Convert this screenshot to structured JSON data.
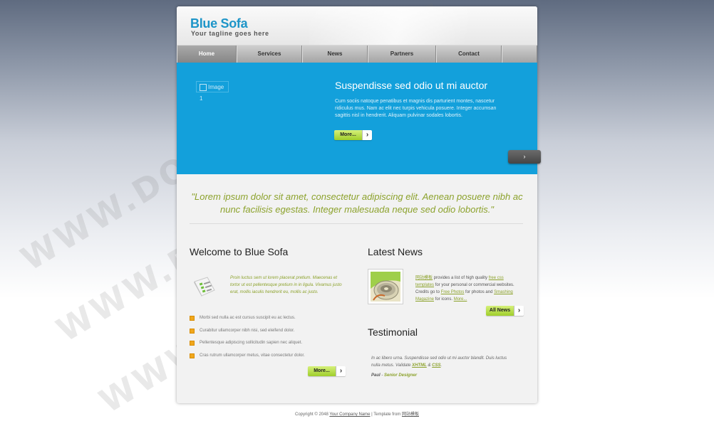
{
  "header": {
    "logo": "Blue Sofa",
    "tagline": "Your tagline goes here"
  },
  "nav": {
    "items": [
      "Home",
      "Services",
      "News",
      "Partners",
      "Contact"
    ],
    "active": "Home"
  },
  "hero": {
    "image_alt": "Image 1",
    "title": "Suspendisse sed odio ut mi auctor",
    "text": "Cum sociis natoque penatibus et magnis dis parturient montes, nascetur ridiculus mus. Nam ac elit nec turpis vehicula posuere. Integer accumsan sagittis nisl in hendrerit. Aliquam pulvinar sodales lobortis.",
    "more_label": "More...",
    "next_icon": "chevron-right-icon"
  },
  "quote": "\"Lorem ipsum dolor sit amet, consectetur adipiscing elit. Aenean posuere nibh ac nunc facilisis egestas. Integer malesuada neque sed odio lobortis.\"",
  "welcome": {
    "title": "Welcome to Blue Sofa",
    "icon": "document-list-icon",
    "intro": "Proin luctus sem ut lorem placerat pretium. Maecenas et tortor ut est pellentesque pretium in in ligula. Vivamus justo erat, mollis iaculis hendrerit eu, mollis ac justo.",
    "bullets": [
      "Morbi sed nulla ac est cursus suscipit eu ac lectus.",
      "Curabitur ullamcorper nibh nisi, sed eleifend dolor.",
      "Pellentesque adipiscing sollicitudin sapien nec aliquet.",
      "Cras rutrum ullamcorper metus, vitae consectetur dolor."
    ],
    "more_label": "More..."
  },
  "news": {
    "title": "Latest News",
    "thumb_icon": "cd-disc-icon",
    "link_site": "网站模板",
    "t1": " provides a list of high quality ",
    "link_free_css": "free css templates",
    "t2": " for your personal or commercial websites. Credits go to ",
    "link_free_photos": "Free Photos",
    "t3": " for photos and ",
    "link_smashing": "Smashing Magazine",
    "t4": " for icons. ",
    "link_more": "More...",
    "all_news_label": "All News"
  },
  "testimonial": {
    "title": "Testimonial",
    "text": "In ac libero urna. Suspendisse sed odio ut mi auctor blandit. Duis luctus nulla metus. Validate ",
    "link_xhtml": "XHTML",
    "amp": " & ",
    "link_css": "CSS",
    "end": ".",
    "author": "Paul",
    "sep": " - ",
    "role": "Senior Designer"
  },
  "footer": {
    "copyright": "Copyright © 2048 ",
    "company": "Your Company Name",
    "mid": " | Template from ",
    "template_link": "网站模板"
  },
  "watermark": "WWW.DOWNDEMO.COM"
}
